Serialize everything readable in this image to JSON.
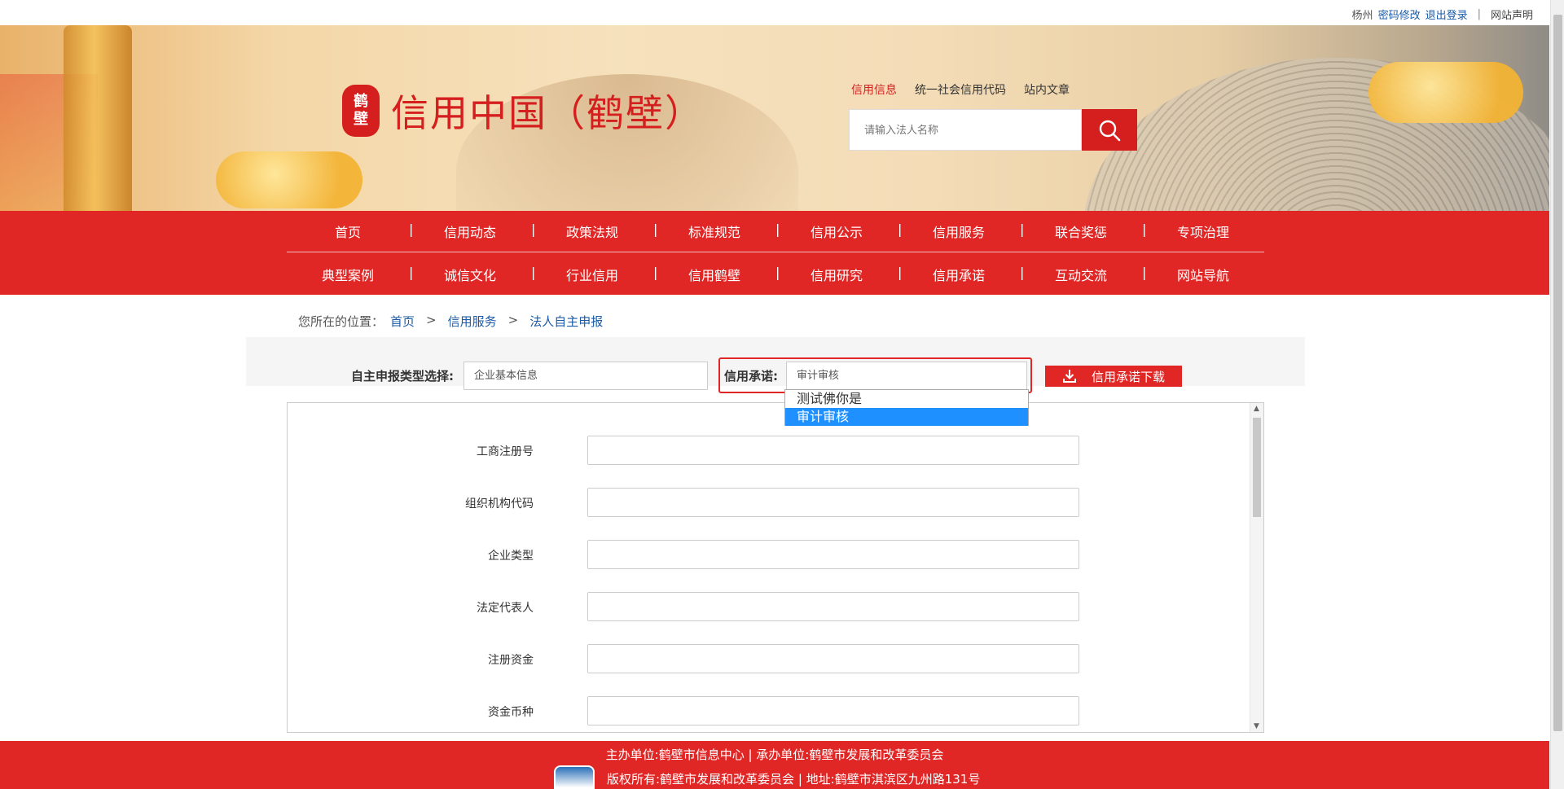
{
  "topbar": {
    "user": "杨州",
    "change_password": "密码修改",
    "logout": "退出登录",
    "separator": "|",
    "site_statement": "网站声明"
  },
  "header": {
    "seal_text_1": "鹤",
    "seal_text_2": "壁",
    "site_title": "信用中国（鹤壁）",
    "search_tabs": [
      "信用信息",
      "统一社会信用代码",
      "站内文章"
    ],
    "search_placeholder": "请输入法人名称"
  },
  "nav": {
    "row1": [
      "首页",
      "信用动态",
      "政策法规",
      "标准规范",
      "信用公示",
      "信用服务",
      "联合奖惩",
      "专项治理"
    ],
    "row2": [
      "典型案例",
      "诚信文化",
      "行业信用",
      "信用鹤壁",
      "信用研究",
      "信用承诺",
      "互动交流",
      "网站导航"
    ]
  },
  "breadcrumb": {
    "prefix": "您所在的位置：",
    "items": [
      "首页",
      "信用服务",
      "法人自主申报"
    ],
    "arrow": ">"
  },
  "select_panel": {
    "type_label": "自主申报类型选择:",
    "type_value": "企业基本信息",
    "promise_label": "信用承诺:",
    "promise_value": "审计审核",
    "download_label": "信用承诺下载",
    "dropdown_options": [
      "测试佛你是",
      "审计审核"
    ],
    "dropdown_selected": "审计审核"
  },
  "form": {
    "fields": [
      "工商注册号",
      "组织机构代码",
      "企业类型",
      "法定代表人",
      "注册资金",
      "资金币种"
    ]
  },
  "footer": {
    "line1": "主办单位:鹤壁市信息中心 |   承办单位:鹤壁市发展和改革委员会",
    "line2": "版权所有:鹤壁市发展和改革委员会 |   地址:鹤壁市淇滨区九州路131号"
  },
  "colors": {
    "brand_red": "#e02726",
    "link_blue": "#1a5aa6",
    "selected_option": "#1e90ff"
  }
}
